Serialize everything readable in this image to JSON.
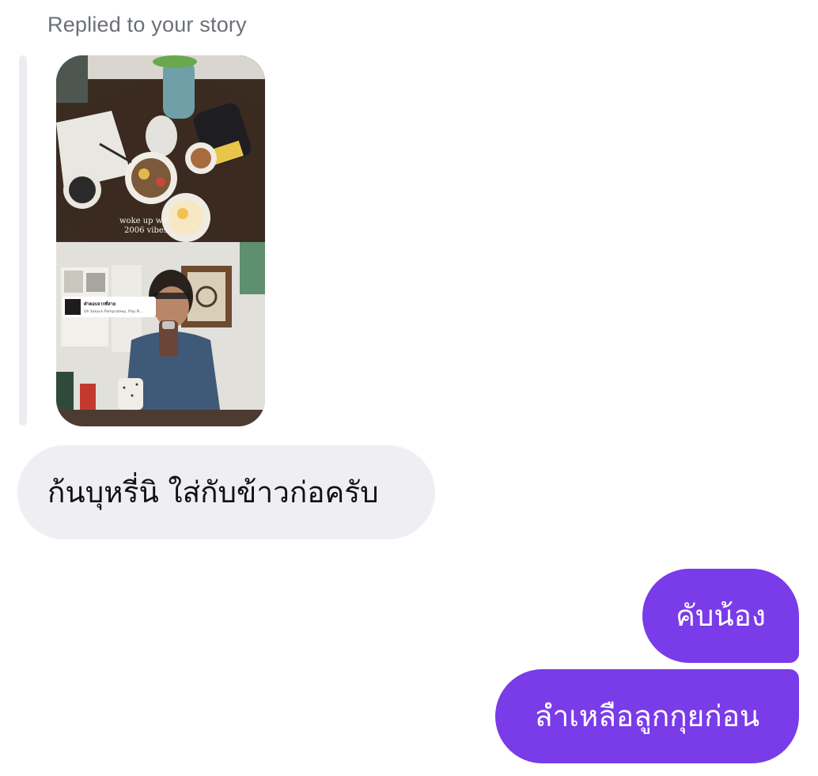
{
  "story_reply": {
    "label": "Replied to your story",
    "story_text": "woke up with\n2006 vibes",
    "music_sticker": {
      "title": "คำตอบจากที่สาย",
      "artist": "Oh Sakaun Pamprateep, Play N..."
    }
  },
  "messages": [
    {
      "direction": "incoming",
      "text": "ก้นบุหรี่นิ ใส่กับข้าวก่อครับ"
    },
    {
      "direction": "outgoing",
      "text": "คับน้อง"
    },
    {
      "direction": "outgoing",
      "text": "ลำเหลือลูกกุยก่อน"
    }
  ],
  "colors": {
    "outgoing_bubble": "#7a3be8",
    "incoming_bubble": "#efeff3",
    "reply_label": "#6b6f76",
    "quote_bar": "#ececf1"
  }
}
